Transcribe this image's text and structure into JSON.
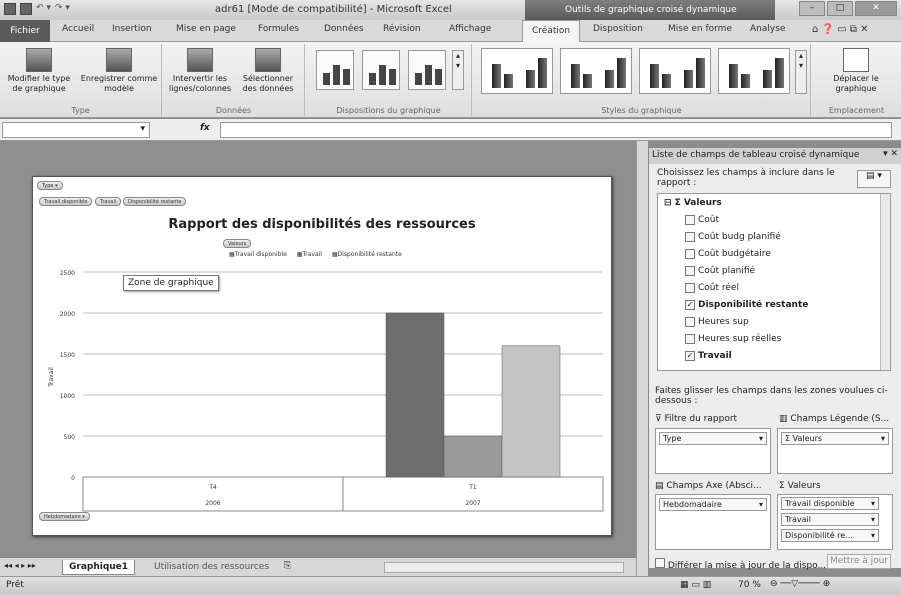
{
  "window": {
    "title": "adr61 [Mode de compatibilité] - Microsoft Excel",
    "context_tab": "Outils de graphique croisé dynamique"
  },
  "tabs": [
    "Fichier",
    "Accueil",
    "Insertion",
    "Mise en page",
    "Formules",
    "Données",
    "Révision",
    "Affichage",
    "Création",
    "Disposition",
    "Mise en forme",
    "Analyse"
  ],
  "ribbon": {
    "type": {
      "label": "Type",
      "change": "Modifier le type de graphique",
      "save": "Enregistrer comme modèle"
    },
    "data": {
      "label": "Données",
      "switch": "Intervertir les lignes/colonnes",
      "select": "Sélectionner des données"
    },
    "layouts": {
      "label": "Dispositions du graphique"
    },
    "styles": {
      "label": "Styles du graphique"
    },
    "location": {
      "label": "Emplacement",
      "move": "Déplacer le graphique"
    }
  },
  "formula": {
    "fx": "fx"
  },
  "chart": {
    "field_buttons": {
      "type": "Type",
      "top1": "Travail disponible",
      "top2": "Travail",
      "top3": "Disponibilité restante",
      "values": "Valeurs",
      "axis": "Hebdomadaire"
    },
    "tooltip": "Zone de graphique"
  },
  "chart_data": {
    "type": "bar",
    "title": "Rapport des disponibilités des ressources",
    "ylabel": "Travail",
    "ylim": [
      0,
      2500
    ],
    "yticks": [
      0,
      500,
      1000,
      1500,
      2000,
      2500
    ],
    "categories": [
      {
        "label": "T4",
        "year": "2006"
      },
      {
        "label": "T1",
        "year": "2007"
      }
    ],
    "series": [
      {
        "name": "Travail disponible",
        "values": [
          0,
          2000
        ],
        "color": "#6e6e6e"
      },
      {
        "name": "Travail",
        "values": [
          0,
          500
        ],
        "color": "#9a9a9a"
      },
      {
        "name": "Disponibilité restante",
        "values": [
          0,
          1600
        ],
        "color": "#c4c4c4"
      }
    ],
    "grid": true,
    "legend": "top"
  },
  "panel": {
    "title": "Liste de champs de tableau croisé dynamique",
    "instruction": "Choisissez les champs à inclure dans le rapport :",
    "group": "Valeurs",
    "fields": [
      {
        "name": "Coût",
        "checked": false
      },
      {
        "name": "Coût budg planifié",
        "checked": false
      },
      {
        "name": "Coût budgétaire",
        "checked": false
      },
      {
        "name": "Coût planifié",
        "checked": false
      },
      {
        "name": "Coût réel",
        "checked": false
      },
      {
        "name": "Disponibilité restante",
        "checked": true
      },
      {
        "name": "Heures sup",
        "checked": false
      },
      {
        "name": "Heures sup réelles",
        "checked": false
      },
      {
        "name": "Travail",
        "checked": true
      }
    ],
    "drag_hint": "Faites glisser les champs dans les zones voulues ci-dessous :",
    "filter_label": "Filtre du rapport",
    "legend_label": "Champs Légende (S...",
    "axis_label": "Champs Axe (Absci...",
    "values_label": "Valeurs",
    "filter_item": "Type",
    "legend_item": "Σ Valeurs",
    "axis_item": "Hebdomadaire",
    "value_items": [
      "Travail disponible",
      "Travail",
      "Disponibilité re..."
    ],
    "defer": "Différer la mise à jour de la dispo...",
    "update": "Mettre à jour"
  },
  "sheets": [
    "Graphique1",
    "Utilisation des ressources"
  ],
  "status": {
    "ready": "Prêt",
    "zoom": "70 %"
  }
}
